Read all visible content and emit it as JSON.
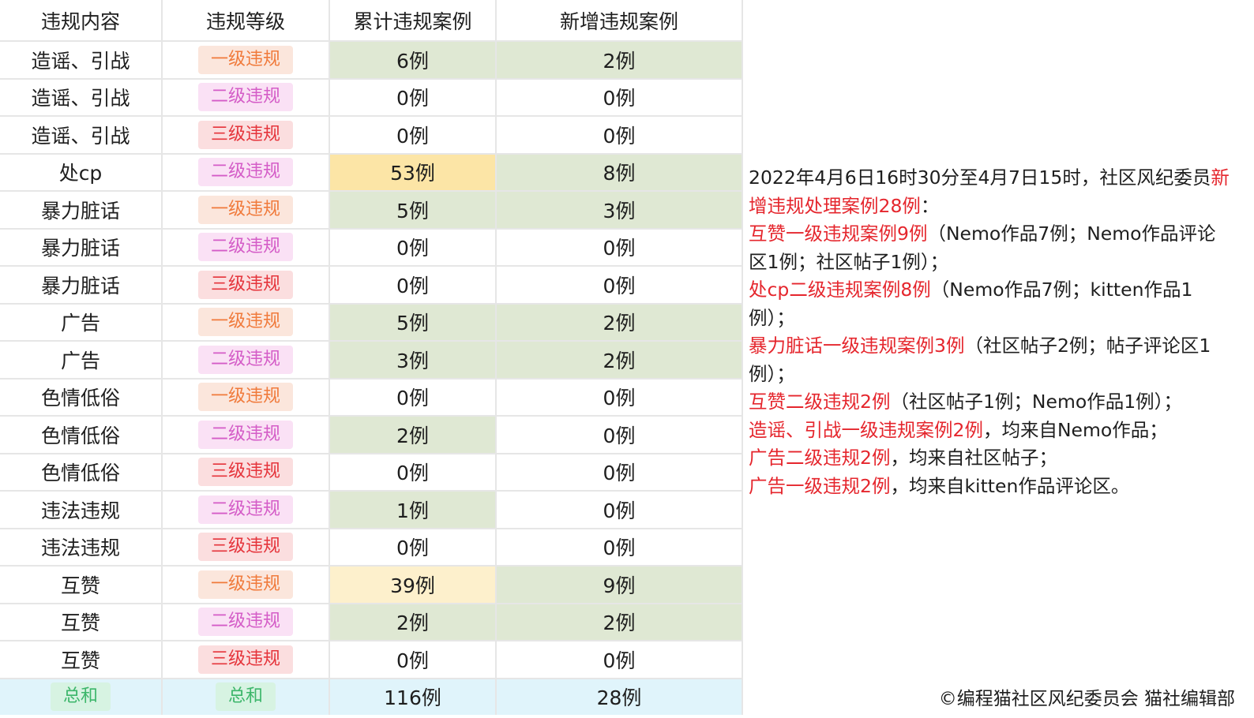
{
  "table": {
    "headers": [
      "违规内容",
      "违规等级",
      "累计违规案例",
      "新增违规案例"
    ],
    "rows": [
      {
        "content": "造谣、引战",
        "level": "一级违规",
        "lv": "1",
        "total": "6例",
        "total_bg": "green",
        "new": "2例",
        "new_bg": "green"
      },
      {
        "content": "造谣、引战",
        "level": "二级违规",
        "lv": "2",
        "total": "0例",
        "total_bg": "",
        "new": "0例",
        "new_bg": ""
      },
      {
        "content": "造谣、引战",
        "level": "三级违规",
        "lv": "3",
        "total": "0例",
        "total_bg": "",
        "new": "0例",
        "new_bg": ""
      },
      {
        "content": "处cp",
        "level": "二级违规",
        "lv": "2",
        "total": "53例",
        "total_bg": "yellow",
        "new": "8例",
        "new_bg": "green"
      },
      {
        "content": "暴力脏话",
        "level": "一级违规",
        "lv": "1",
        "total": "5例",
        "total_bg": "green",
        "new": "3例",
        "new_bg": "green"
      },
      {
        "content": "暴力脏话",
        "level": "二级违规",
        "lv": "2",
        "total": "0例",
        "total_bg": "",
        "new": "0例",
        "new_bg": ""
      },
      {
        "content": "暴力脏话",
        "level": "三级违规",
        "lv": "3",
        "total": "0例",
        "total_bg": "",
        "new": "0例",
        "new_bg": ""
      },
      {
        "content": "广告",
        "level": "一级违规",
        "lv": "1",
        "total": "5例",
        "total_bg": "green",
        "new": "2例",
        "new_bg": "green"
      },
      {
        "content": "广告",
        "level": "二级违规",
        "lv": "2",
        "total": "3例",
        "total_bg": "green",
        "new": "2例",
        "new_bg": "green"
      },
      {
        "content": "色情低俗",
        "level": "一级违规",
        "lv": "1",
        "total": "0例",
        "total_bg": "",
        "new": "0例",
        "new_bg": ""
      },
      {
        "content": "色情低俗",
        "level": "二级违规",
        "lv": "2",
        "total": "2例",
        "total_bg": "green",
        "new": "0例",
        "new_bg": ""
      },
      {
        "content": "色情低俗",
        "level": "三级违规",
        "lv": "3",
        "total": "0例",
        "total_bg": "",
        "new": "0例",
        "new_bg": ""
      },
      {
        "content": "违法违规",
        "level": "二级违规",
        "lv": "2",
        "total": "1例",
        "total_bg": "green",
        "new": "0例",
        "new_bg": ""
      },
      {
        "content": "违法违规",
        "level": "三级违规",
        "lv": "3",
        "total": "0例",
        "total_bg": "",
        "new": "0例",
        "new_bg": ""
      },
      {
        "content": "互赞",
        "level": "一级违规",
        "lv": "1",
        "total": "39例",
        "total_bg": "light-yellow",
        "new": "9例",
        "new_bg": "green"
      },
      {
        "content": "互赞",
        "level": "二级违规",
        "lv": "2",
        "total": "2例",
        "total_bg": "green",
        "new": "2例",
        "new_bg": "green"
      },
      {
        "content": "互赞",
        "level": "三级违规",
        "lv": "3",
        "total": "0例",
        "total_bg": "",
        "new": "0例",
        "new_bg": ""
      }
    ],
    "total_row": {
      "content": "总和",
      "level": "总和",
      "total": "116例",
      "new": "28例"
    }
  },
  "colors": {
    "level1": "#f07a3b",
    "level2": "#d45cc7",
    "level3": "#e5343b",
    "sum": "#3cb66a",
    "cell_green": "#dfe8d3",
    "cell_yellow": "#fce5a6",
    "cell_light_yellow": "#fdf0cc",
    "total_row": "#e0f4fb",
    "highlight_red": "#e5262d"
  },
  "summary": {
    "segments": [
      {
        "text": "2022年4月6日16时30分至4月7日15时，社区风纪委员",
        "red": false
      },
      {
        "text": "新增违规处理案例28例",
        "red": true
      },
      {
        "text": "：",
        "red": false,
        "br": true
      },
      {
        "text": "互赞一级违规案例9例",
        "red": true
      },
      {
        "text": "（Nemo作品7例；Nemo作品评论区1例；社区帖子1例）；",
        "red": false,
        "br": true
      },
      {
        "text": "处cp二级违规案例8例",
        "red": true
      },
      {
        "text": "（Nemo作品7例；kitten作品1例）；",
        "red": false,
        "br": true
      },
      {
        "text": "暴力脏话一级违规案例3例",
        "red": true
      },
      {
        "text": "（社区帖子2例；帖子评论区1例）；",
        "red": false,
        "br": true
      },
      {
        "text": "互赞二级违规2例",
        "red": true
      },
      {
        "text": "（社区帖子1例；Nemo作品1例）；",
        "red": false,
        "br": true
      },
      {
        "text": "造谣、引战一级违规案例2例",
        "red": true
      },
      {
        "text": "，均来自Nemo作品；",
        "red": false,
        "br": true
      },
      {
        "text": "广告二级违规2例",
        "red": true
      },
      {
        "text": "，均来自社区帖子；",
        "red": false,
        "br": true
      },
      {
        "text": "广告一级违规2例",
        "red": true
      },
      {
        "text": "，均来自kitten作品评论区。",
        "red": false
      }
    ]
  },
  "footer": "©编程猫社区风纪委员会 猫社编辑部"
}
